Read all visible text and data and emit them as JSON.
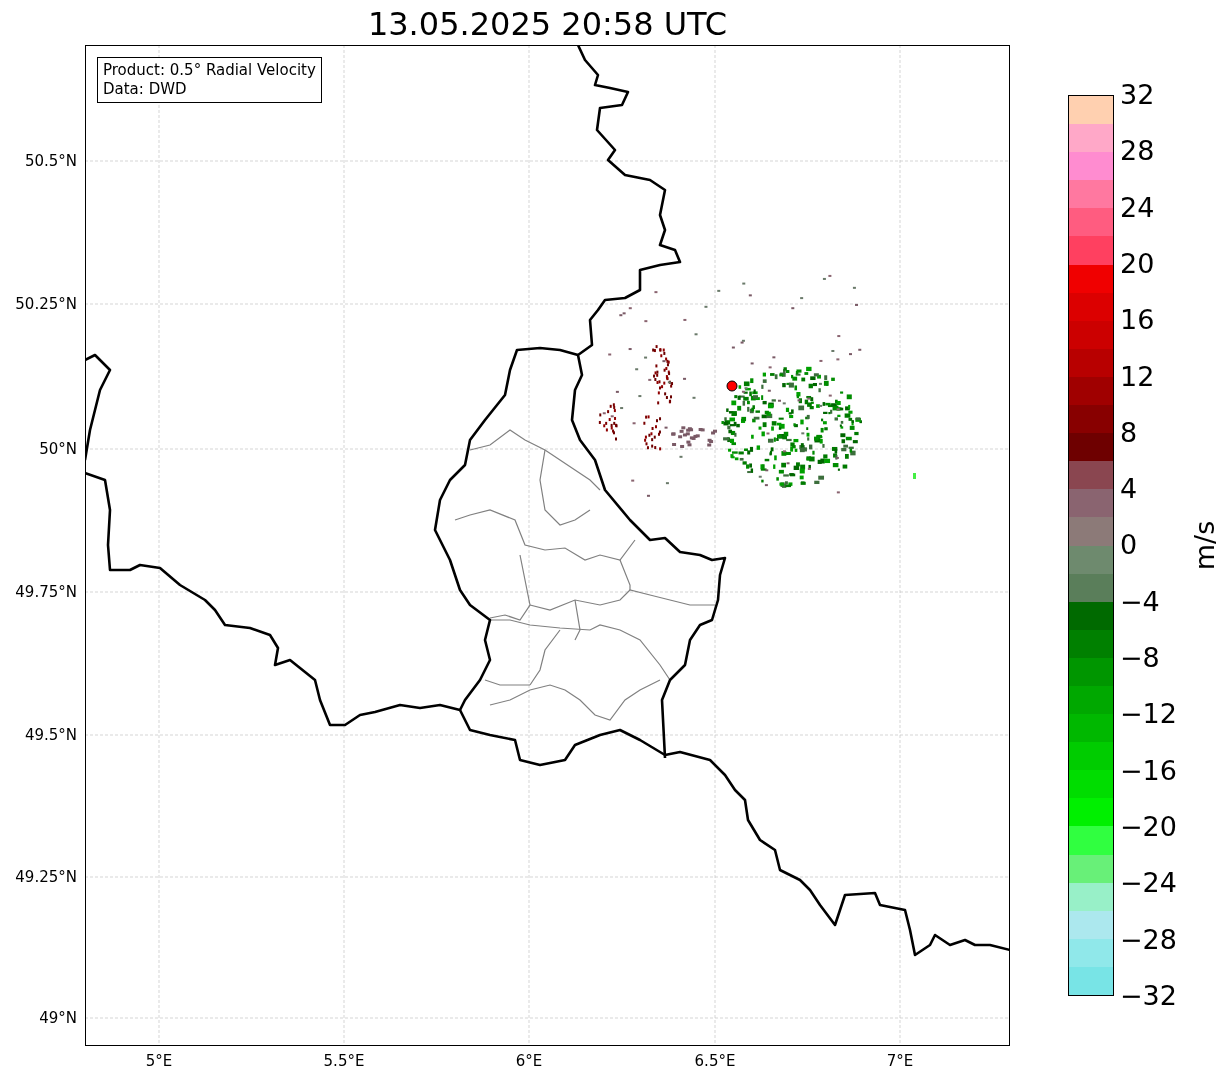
{
  "title": "13.05.2025 20:58 UTC",
  "map": {
    "legend": [
      "Product: 0.5° Radial Velocity",
      "Data: DWD"
    ],
    "y_ticks": [
      "50.5°N",
      "50.25°N",
      "50°N",
      "49.75°N",
      "49.5°N",
      "49.25°N",
      "49°N"
    ],
    "x_ticks": [
      "5°E",
      "5.5°E",
      "6°E",
      "6.5°E",
      "7°E"
    ]
  },
  "colorbar": {
    "label": "m/s",
    "ticks": [
      "32",
      "28",
      "24",
      "20",
      "16",
      "12",
      "8",
      "4",
      "0",
      "−4",
      "−8",
      "−12",
      "−16",
      "−20",
      "−24",
      "−28",
      "−32"
    ],
    "bins": [
      {
        "color": "#ffd0b0"
      },
      {
        "color": "#ffa8c8"
      },
      {
        "color": "#ff8cd0"
      },
      {
        "color": "#ff78a0"
      },
      {
        "color": "#ff5c80"
      },
      {
        "color": "#ff4060"
      },
      {
        "color": "#f00000"
      },
      {
        "color": "#dc0000"
      },
      {
        "color": "#cc0000"
      },
      {
        "color": "#b80000"
      },
      {
        "color": "#a00000"
      },
      {
        "color": "#880000"
      },
      {
        "color": "#6e0000"
      },
      {
        "color": "#8a4650"
      },
      {
        "color": "#8a6470"
      },
      {
        "color": "#8c7a78"
      },
      {
        "color": "#6e8a6e"
      },
      {
        "color": "#5a7e5a"
      },
      {
        "color": "#006a00"
      },
      {
        "color": "#008000"
      },
      {
        "color": "#009600"
      },
      {
        "color": "#00a800"
      },
      {
        "color": "#00b800"
      },
      {
        "color": "#00cc00"
      },
      {
        "color": "#00dd00"
      },
      {
        "color": "#00f000"
      },
      {
        "color": "#30ff40"
      },
      {
        "color": "#68f078"
      },
      {
        "color": "#98f0c8"
      },
      {
        "color": "#ace8ee"
      },
      {
        "color": "#90e8ea"
      },
      {
        "color": "#78e4e6"
      }
    ]
  }
}
